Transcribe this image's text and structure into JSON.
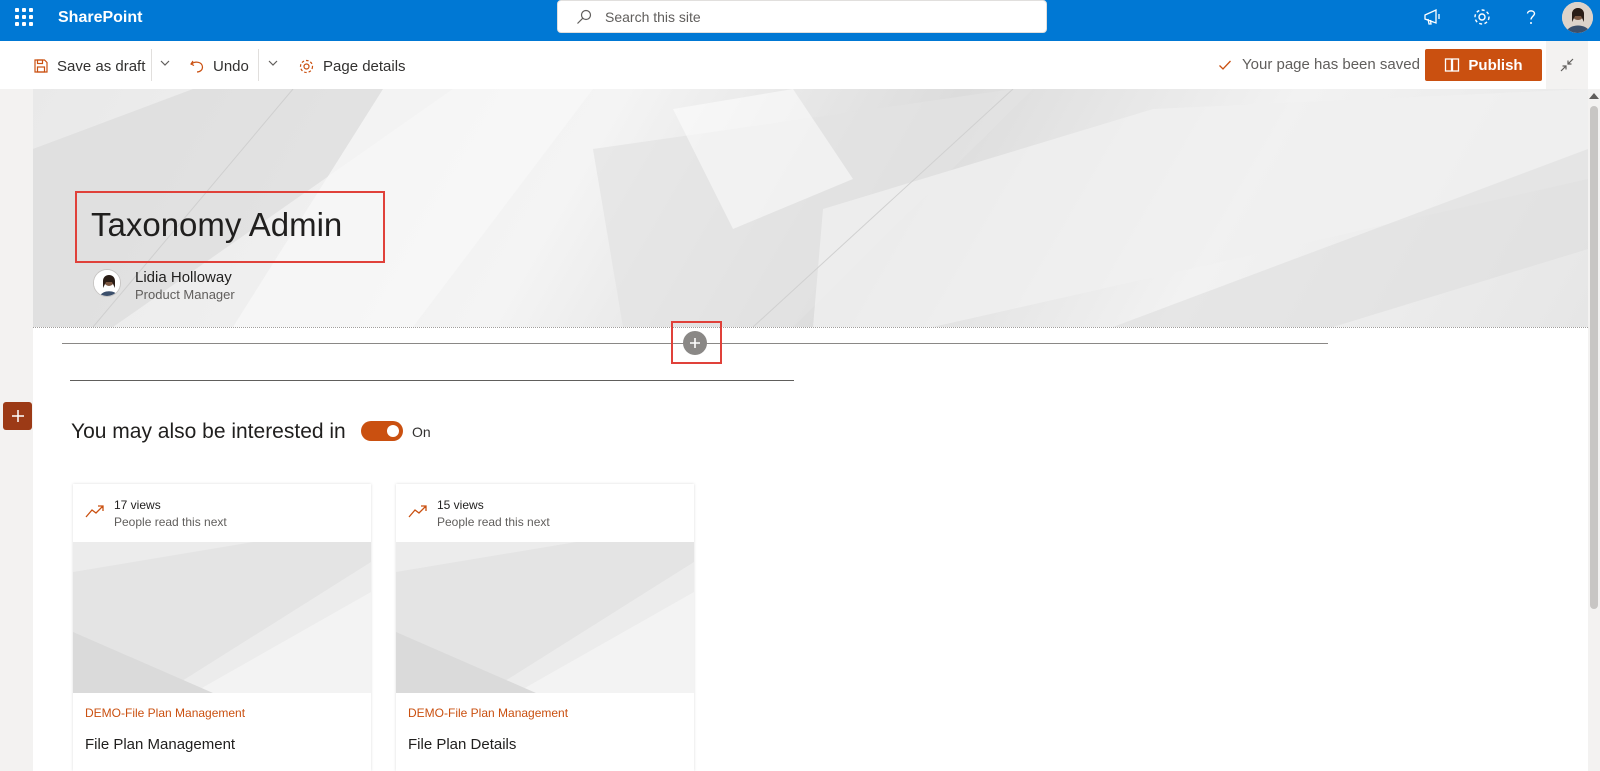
{
  "suite": {
    "brand": "SharePoint",
    "search_placeholder": "Search this site"
  },
  "toolbar": {
    "save_draft": "Save as draft",
    "undo": "Undo",
    "page_details": "Page details",
    "status": "Your page has been saved",
    "publish": "Publish"
  },
  "hero": {
    "title": "Taxonomy Admin",
    "author_name": "Lidia Holloway",
    "author_role": "Product Manager"
  },
  "related": {
    "heading": "You may also be interested in",
    "toggle_label": "On",
    "toggle_on": true,
    "cards": [
      {
        "views": "17 views",
        "subtitle": "People read this next",
        "site": "DEMO-File Plan Management",
        "title": "File Plan Management"
      },
      {
        "views": "15 views",
        "subtitle": "People read this next",
        "site": "DEMO-File Plan Management",
        "title": "File Plan Details"
      }
    ]
  },
  "colors": {
    "suite_bar": "#0078d4",
    "accent": "#ca5010",
    "annotation": "#e0413a"
  },
  "icons": [
    "app-launcher-icon",
    "search-icon",
    "megaphone-icon",
    "gear-icon",
    "help-icon",
    "save-icon",
    "undo-icon",
    "chevron-down-icon",
    "settings-icon",
    "checkmark-icon",
    "book-icon",
    "collapse-icon",
    "add-icon",
    "trending-icon"
  ]
}
